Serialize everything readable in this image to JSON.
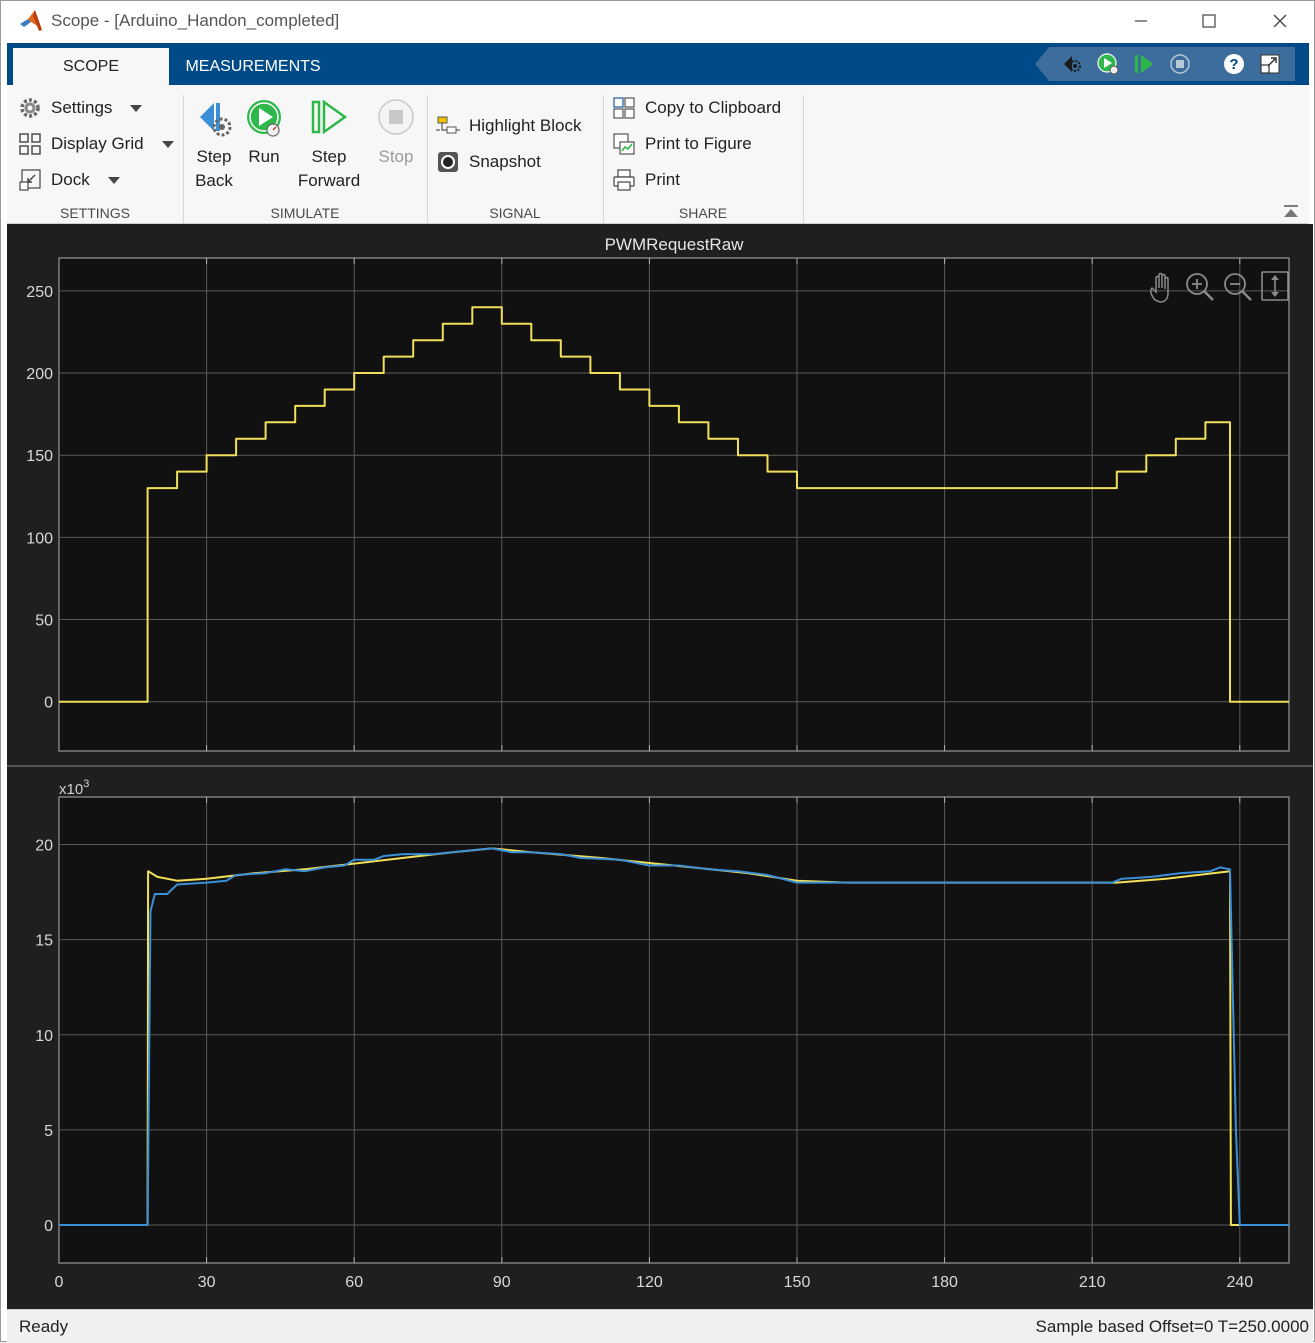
{
  "window": {
    "title": "Scope - [Arduino_Handon_completed]",
    "controls": [
      "minimize",
      "maximize",
      "close"
    ]
  },
  "tabs": [
    {
      "label": "SCOPE",
      "active": true
    },
    {
      "label": "MEASUREMENTS",
      "active": false
    }
  ],
  "ribbon": {
    "settings": {
      "section_label": "SETTINGS",
      "settings_label": "Settings",
      "display_grid_label": "Display Grid",
      "dock_label": "Dock"
    },
    "simulate": {
      "section_label": "SIMULATE",
      "step_back_line1": "Step",
      "step_back_line2": "Back",
      "run_label": "Run",
      "step_forward_line1": "Step",
      "step_forward_line2": "Forward",
      "stop_label": "Stop"
    },
    "signal": {
      "section_label": "SIGNAL",
      "highlight_block_label": "Highlight Block",
      "snapshot_label": "Snapshot"
    },
    "share": {
      "section_label": "SHARE",
      "copy_label": "Copy to Clipboard",
      "print_figure_label": "Print to Figure",
      "print_label": "Print"
    }
  },
  "colors": {
    "accent": "#004b87",
    "plot_bg": "#111111",
    "scope_bg": "#1f1f1f",
    "series_yellow": "#f2e05a",
    "series_blue": "#3b8fd6",
    "grid": "#5a5a5a"
  },
  "chart_data": [
    {
      "type": "line",
      "title": "PWMRequestRaw",
      "xlabel": "",
      "ylabel": "",
      "xlim": [
        0,
        250
      ],
      "ylim": [
        -30,
        270
      ],
      "yticks": [
        0,
        50,
        100,
        150,
        200,
        250
      ],
      "xticks": [
        0,
        30,
        60,
        90,
        120,
        150,
        180,
        210,
        240
      ],
      "show_xtick_labels": false,
      "grid": true,
      "series": [
        {
          "color": "#f2e05a",
          "step": true,
          "points": [
            [
              0,
              0
            ],
            [
              18,
              0
            ],
            [
              18,
              130
            ],
            [
              24,
              130
            ],
            [
              24,
              140
            ],
            [
              30,
              140
            ],
            [
              30,
              150
            ],
            [
              36,
              150
            ],
            [
              36,
              160
            ],
            [
              42,
              160
            ],
            [
              42,
              170
            ],
            [
              48,
              170
            ],
            [
              48,
              180
            ],
            [
              54,
              180
            ],
            [
              54,
              190
            ],
            [
              60,
              190
            ],
            [
              60,
              200
            ],
            [
              66,
              200
            ],
            [
              66,
              210
            ],
            [
              72,
              210
            ],
            [
              72,
              220
            ],
            [
              78,
              220
            ],
            [
              78,
              230
            ],
            [
              84,
              230
            ],
            [
              84,
              240
            ],
            [
              90,
              240
            ],
            [
              90,
              230
            ],
            [
              96,
              230
            ],
            [
              96,
              220
            ],
            [
              102,
              220
            ],
            [
              102,
              210
            ],
            [
              108,
              210
            ],
            [
              108,
              200
            ],
            [
              114,
              200
            ],
            [
              114,
              190
            ],
            [
              120,
              190
            ],
            [
              120,
              180
            ],
            [
              126,
              180
            ],
            [
              126,
              170
            ],
            [
              132,
              170
            ],
            [
              132,
              160
            ],
            [
              138,
              160
            ],
            [
              138,
              150
            ],
            [
              144,
              150
            ],
            [
              144,
              140
            ],
            [
              150,
              140
            ],
            [
              150,
              130
            ],
            [
              215,
              130
            ],
            [
              215,
              140
            ],
            [
              221,
              140
            ],
            [
              221,
              150
            ],
            [
              227,
              150
            ],
            [
              227,
              160
            ],
            [
              233,
              160
            ],
            [
              233,
              170
            ],
            [
              238,
              170
            ],
            [
              238,
              0
            ],
            [
              250,
              0
            ]
          ]
        }
      ]
    },
    {
      "type": "line",
      "title": "",
      "xlabel": "",
      "ylabel": "",
      "exponent_label": "x10",
      "exponent_power": "3",
      "xlim": [
        0,
        250
      ],
      "ylim": [
        -2,
        22.5
      ],
      "yticks": [
        0,
        5,
        10,
        15,
        20
      ],
      "xticks": [
        0,
        30,
        60,
        90,
        120,
        150,
        180,
        210,
        240
      ],
      "show_xtick_labels": true,
      "grid": true,
      "series": [
        {
          "color": "#f2e05a",
          "step": false,
          "points": [
            [
              0,
              0
            ],
            [
              18,
              0
            ],
            [
              18.1,
              18.6
            ],
            [
              20,
              18.3
            ],
            [
              24,
              18.1
            ],
            [
              30,
              18.2
            ],
            [
              40,
              18.5
            ],
            [
              50,
              18.7
            ],
            [
              60,
              19.0
            ],
            [
              70,
              19.3
            ],
            [
              80,
              19.6
            ],
            [
              88,
              19.8
            ],
            [
              96,
              19.6
            ],
            [
              110,
              19.3
            ],
            [
              125,
              18.9
            ],
            [
              140,
              18.5
            ],
            [
              150,
              18.1
            ],
            [
              160,
              18.0
            ],
            [
              215,
              18.0
            ],
            [
              225,
              18.2
            ],
            [
              238,
              18.6
            ],
            [
              238.2,
              0
            ],
            [
              250,
              0
            ]
          ]
        },
        {
          "color": "#3b8fd6",
          "step": false,
          "points": [
            [
              0,
              0
            ],
            [
              18,
              0
            ],
            [
              18.6,
              16.5
            ],
            [
              19.5,
              17.4
            ],
            [
              22,
              17.4
            ],
            [
              24,
              17.9
            ],
            [
              30,
              18.0
            ],
            [
              34,
              18.1
            ],
            [
              36,
              18.4
            ],
            [
              42,
              18.5
            ],
            [
              46,
              18.7
            ],
            [
              50,
              18.6
            ],
            [
              54,
              18.8
            ],
            [
              58,
              18.9
            ],
            [
              60,
              19.2
            ],
            [
              64,
              19.2
            ],
            [
              66,
              19.4
            ],
            [
              70,
              19.5
            ],
            [
              74,
              19.5
            ],
            [
              76,
              19.5
            ],
            [
              80,
              19.6
            ],
            [
              84,
              19.7
            ],
            [
              88,
              19.8
            ],
            [
              92,
              19.6
            ],
            [
              96,
              19.6
            ],
            [
              102,
              19.5
            ],
            [
              106,
              19.3
            ],
            [
              114,
              19.2
            ],
            [
              120,
              18.9
            ],
            [
              126,
              18.9
            ],
            [
              132,
              18.7
            ],
            [
              138,
              18.6
            ],
            [
              144,
              18.4
            ],
            [
              150,
              18.0
            ],
            [
              156,
              18.0
            ],
            [
              214,
              18.0
            ],
            [
              216,
              18.2
            ],
            [
              222,
              18.3
            ],
            [
              228,
              18.5
            ],
            [
              234,
              18.6
            ],
            [
              236,
              18.8
            ],
            [
              238,
              18.7
            ],
            [
              239.2,
              5
            ],
            [
              240,
              0
            ],
            [
              250,
              0
            ]
          ]
        }
      ]
    }
  ],
  "status": {
    "left": "Ready",
    "right": "Sample based  Offset=0  T=250.0000"
  }
}
